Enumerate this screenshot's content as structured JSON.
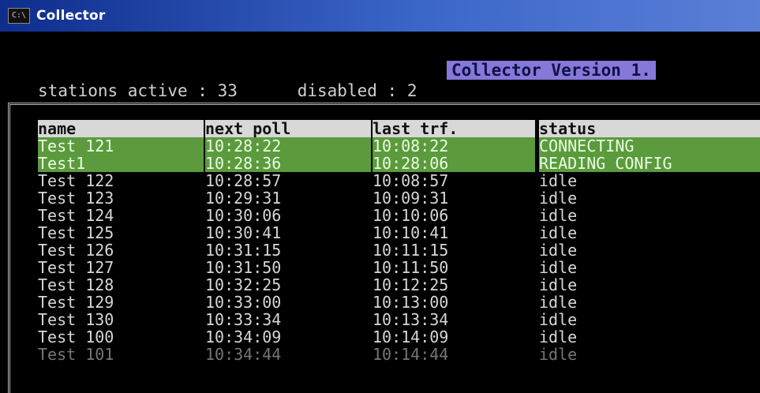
{
  "window": {
    "title": "Collector",
    "icon_text": "C:\\",
    "icon_name": "console-window-icon"
  },
  "banner": {
    "version_text": "Collector Version 1."
  },
  "stats": {
    "active_label": "stations active : ",
    "active_count": "33",
    "disabled_label": "disabled : ",
    "disabled_count": "2"
  },
  "table": {
    "columns": [
      "name",
      "next poll",
      "last trf.",
      "status"
    ],
    "rows": [
      {
        "name": "Test 121",
        "next_poll": "10:28:22",
        "last_trf": "10:08:22",
        "status": "CONNECTING",
        "state": "active"
      },
      {
        "name": "Test1",
        "next_poll": "10:28:36",
        "last_trf": "10:28:06",
        "status": "READING CONFIG",
        "state": "active"
      },
      {
        "name": "Test 122",
        "next_poll": "10:28:57",
        "last_trf": "10:08:57",
        "status": "idle",
        "state": "idle"
      },
      {
        "name": "Test 123",
        "next_poll": "10:29:31",
        "last_trf": "10:09:31",
        "status": "idle",
        "state": "idle"
      },
      {
        "name": "Test 124",
        "next_poll": "10:30:06",
        "last_trf": "10:10:06",
        "status": "idle",
        "state": "idle"
      },
      {
        "name": "Test 125",
        "next_poll": "10:30:41",
        "last_trf": "10:10:41",
        "status": "idle",
        "state": "idle"
      },
      {
        "name": "Test 126",
        "next_poll": "10:31:15",
        "last_trf": "10:11:15",
        "status": "idle",
        "state": "idle"
      },
      {
        "name": "Test 127",
        "next_poll": "10:31:50",
        "last_trf": "10:11:50",
        "status": "idle",
        "state": "idle"
      },
      {
        "name": "Test 128",
        "next_poll": "10:32:25",
        "last_trf": "10:12:25",
        "status": "idle",
        "state": "idle"
      },
      {
        "name": "Test 129",
        "next_poll": "10:33:00",
        "last_trf": "10:13:00",
        "status": "idle",
        "state": "idle"
      },
      {
        "name": "Test 130",
        "next_poll": "10:33:34",
        "last_trf": "10:13:34",
        "status": "idle",
        "state": "idle"
      },
      {
        "name": "Test 100",
        "next_poll": "10:34:09",
        "last_trf": "10:14:09",
        "status": "idle",
        "state": "idle"
      },
      {
        "name": "Test 101",
        "next_poll": "10:34:44",
        "last_trf": "10:14:44",
        "status": "idle",
        "state": "idle"
      }
    ]
  },
  "colors": {
    "active_row": "#5c9a3e",
    "header_row": "#d8d8d8",
    "version_bg": "#8678d8",
    "titlebar": "#0e2d8c"
  }
}
